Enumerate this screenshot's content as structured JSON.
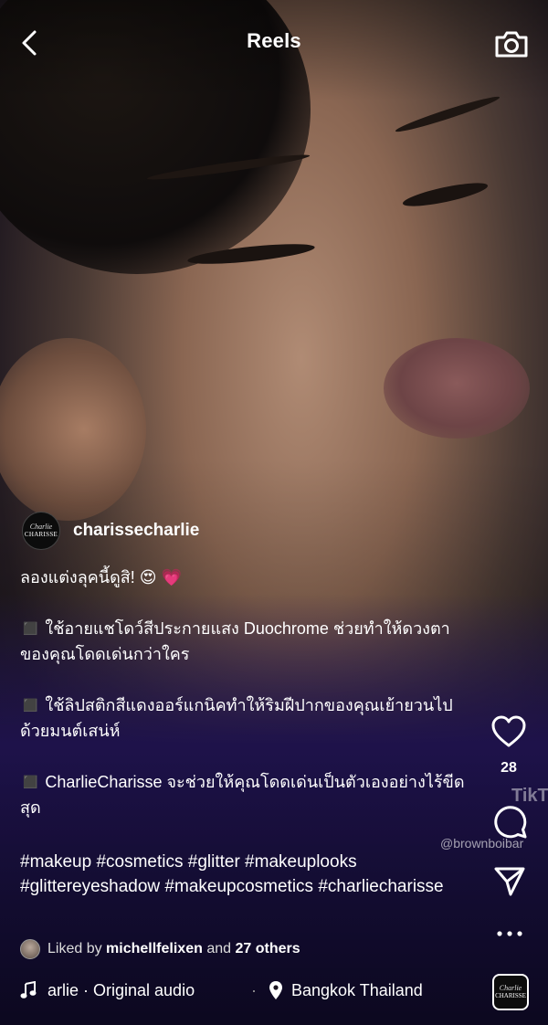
{
  "header": {
    "title": "Reels"
  },
  "post": {
    "author": {
      "username": "charissecharlie",
      "avatar_line1": "Charlie",
      "avatar_line2": "CHARISSE"
    },
    "caption_lines": [
      "ลองแต่งลุคนี้ดูสิ! 😍 💗",
      "◼️ ใช้อายแชโดว์สีประกายแสง Duochrome ช่วยทำให้ดวงตาของคุณโดดเด่นกว่าใคร",
      "◼️ ใช้ลิปสติกสีแดงออร์แกนิคทำให้ริมฝีปากของคุณเย้ายวนไปด้วยมนต์เสน่ห์",
      "◼️ CharlieCharisse จะช่วยให้คุณโดดเด่นเป็นตัวเองอย่างไร้ขีดสุด"
    ],
    "hashtags": "#makeup #cosmetics #glitter #makeuplooks #glittereyeshadow #makeupcosmetics #charliecharisse",
    "liked": {
      "prefix": "Liked by",
      "user": "michellfelixen",
      "middle": "and",
      "others": "27 others"
    },
    "audio": "arlie · Original audio",
    "location": "Bangkok Thailand"
  },
  "actions": {
    "like_count": "28"
  },
  "audio_thumb": {
    "line1": "Charlie",
    "line2": "CHARISSE"
  },
  "watermark": {
    "logo": "TikTo",
    "handle": "@brownboibar"
  },
  "icons": {
    "back": "chevron-left-icon",
    "camera": "camera-icon",
    "like": "heart-icon",
    "comment": "comment-icon",
    "share": "send-icon",
    "more": "more-icon",
    "music": "music-note-icon",
    "location": "location-pin-icon"
  }
}
